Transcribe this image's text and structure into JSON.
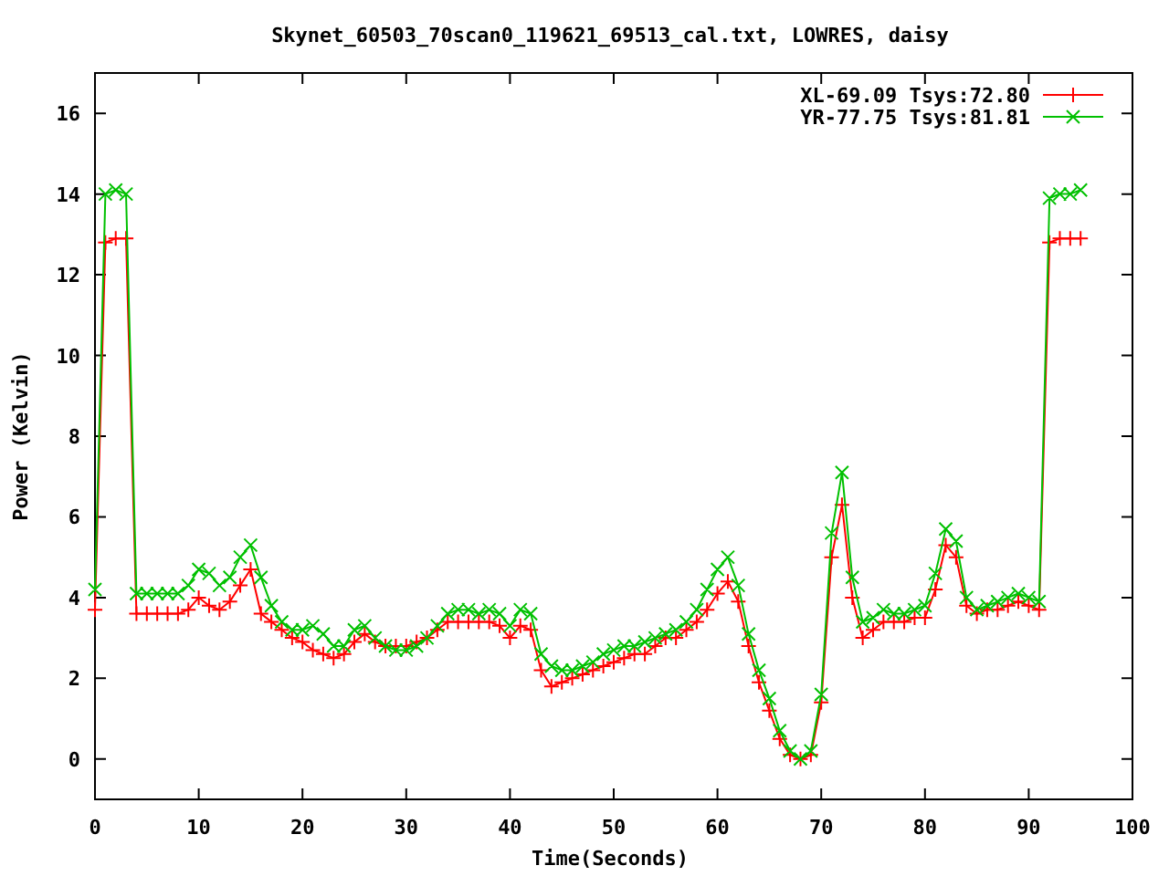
{
  "chart_data": {
    "type": "line",
    "title": "Skynet_60503_70scan0_119621_69513_cal.txt, LOWRES, daisy",
    "xlabel": "Time(Seconds)",
    "ylabel": "Power (Kelvin)",
    "x": [
      0,
      1,
      2,
      3,
      4,
      5,
      6,
      7,
      8,
      9,
      10,
      11,
      12,
      13,
      14,
      15,
      16,
      17,
      18,
      19,
      20,
      21,
      22,
      23,
      24,
      25,
      26,
      27,
      28,
      29,
      30,
      31,
      32,
      33,
      34,
      35,
      36,
      37,
      38,
      39,
      40,
      41,
      42,
      43,
      44,
      45,
      46,
      47,
      48,
      49,
      50,
      51,
      52,
      53,
      54,
      55,
      56,
      57,
      58,
      59,
      60,
      61,
      62,
      63,
      64,
      65,
      66,
      67,
      68,
      69,
      70,
      71,
      72,
      73,
      74,
      75,
      76,
      77,
      78,
      79,
      80,
      81,
      82,
      83,
      84,
      85,
      86,
      87,
      88,
      89,
      90,
      91,
      92,
      93,
      94,
      95
    ],
    "series": [
      {
        "name": "XL-69.09 Tsys:72.80",
        "color": "#ff0000",
        "marker": "plus",
        "values": [
          3.7,
          12.8,
          12.9,
          12.9,
          3.6,
          3.6,
          3.6,
          3.6,
          3.6,
          3.7,
          4.0,
          3.8,
          3.7,
          3.9,
          4.3,
          4.7,
          3.6,
          3.4,
          3.2,
          3.0,
          2.9,
          2.7,
          2.6,
          2.5,
          2.6,
          2.9,
          3.1,
          2.9,
          2.8,
          2.8,
          2.8,
          2.9,
          3.0,
          3.2,
          3.4,
          3.4,
          3.4,
          3.4,
          3.4,
          3.3,
          3.0,
          3.3,
          3.2,
          2.2,
          1.8,
          1.9,
          2.0,
          2.1,
          2.2,
          2.3,
          2.4,
          2.5,
          2.6,
          2.6,
          2.8,
          3.0,
          3.0,
          3.2,
          3.4,
          3.7,
          4.1,
          4.4,
          3.9,
          2.8,
          1.9,
          1.2,
          0.5,
          0.1,
          0.0,
          0.1,
          1.4,
          5.0,
          6.3,
          4.0,
          3.0,
          3.2,
          3.4,
          3.4,
          3.4,
          3.5,
          3.5,
          4.2,
          5.3,
          5.0,
          3.8,
          3.6,
          3.7,
          3.7,
          3.8,
          3.9,
          3.8,
          3.7,
          12.8,
          12.9,
          12.9,
          12.9
        ]
      },
      {
        "name": "YR-77.75 Tsys:81.81",
        "color": "#00c000",
        "marker": "cross",
        "values": [
          4.2,
          14.0,
          14.1,
          14.0,
          4.1,
          4.1,
          4.1,
          4.1,
          4.1,
          4.3,
          4.7,
          4.6,
          4.3,
          4.5,
          5.0,
          5.3,
          4.5,
          3.8,
          3.4,
          3.2,
          3.2,
          3.3,
          3.1,
          2.8,
          2.8,
          3.2,
          3.3,
          3.0,
          2.8,
          2.7,
          2.7,
          2.8,
          3.0,
          3.3,
          3.6,
          3.7,
          3.7,
          3.6,
          3.7,
          3.6,
          3.3,
          3.7,
          3.6,
          2.6,
          2.3,
          2.2,
          2.2,
          2.3,
          2.4,
          2.6,
          2.7,
          2.8,
          2.8,
          2.9,
          3.0,
          3.1,
          3.2,
          3.4,
          3.7,
          4.2,
          4.7,
          5.0,
          4.3,
          3.1,
          2.2,
          1.5,
          0.7,
          0.2,
          0.0,
          0.2,
          1.6,
          5.6,
          7.1,
          4.5,
          3.4,
          3.5,
          3.7,
          3.6,
          3.6,
          3.7,
          3.8,
          4.6,
          5.7,
          5.4,
          4.0,
          3.7,
          3.8,
          3.9,
          4.0,
          4.1,
          4.0,
          3.9,
          13.9,
          14.0,
          14.0,
          14.1
        ]
      }
    ],
    "legend": true,
    "xlim": [
      0,
      100
    ],
    "ylim": [
      -1,
      17
    ],
    "xticks": [
      0,
      10,
      20,
      30,
      40,
      50,
      60,
      70,
      80,
      90,
      100
    ],
    "yticks": [
      0,
      2,
      4,
      6,
      8,
      10,
      12,
      14,
      16
    ]
  }
}
